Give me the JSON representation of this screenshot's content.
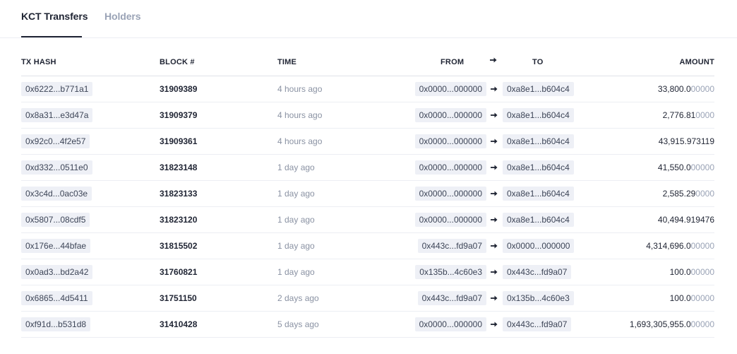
{
  "tabs": [
    {
      "label": "KCT Transfers"
    },
    {
      "label": "Holders"
    }
  ],
  "table": {
    "headers": {
      "tx_hash": "TX HASH",
      "block": "BLOCK #",
      "time": "TIME",
      "from": "FROM",
      "to": "TO",
      "amount": "AMOUNT"
    },
    "rows": [
      {
        "tx_hash": "0x6222...b771a1",
        "block": "31909389",
        "time": "4 hours ago",
        "from": "0x0000...000000",
        "to": "0xa8e1...b604c4",
        "amount_main": "33,800.0",
        "amount_dim": "00000"
      },
      {
        "tx_hash": "0x8a31...e3d47a",
        "block": "31909379",
        "time": "4 hours ago",
        "from": "0x0000...000000",
        "to": "0xa8e1...b604c4",
        "amount_main": "2,776.81",
        "amount_dim": "0000"
      },
      {
        "tx_hash": "0x92c0...4f2e57",
        "block": "31909361",
        "time": "4 hours ago",
        "from": "0x0000...000000",
        "to": "0xa8e1...b604c4",
        "amount_main": "43,915.973119",
        "amount_dim": ""
      },
      {
        "tx_hash": "0xd332...0511e0",
        "block": "31823148",
        "time": "1 day ago",
        "from": "0x0000...000000",
        "to": "0xa8e1...b604c4",
        "amount_main": "41,550.0",
        "amount_dim": "00000"
      },
      {
        "tx_hash": "0x3c4d...0ac03e",
        "block": "31823133",
        "time": "1 day ago",
        "from": "0x0000...000000",
        "to": "0xa8e1...b604c4",
        "amount_main": "2,585.29",
        "amount_dim": "0000"
      },
      {
        "tx_hash": "0x5807...08cdf5",
        "block": "31823120",
        "time": "1 day ago",
        "from": "0x0000...000000",
        "to": "0xa8e1...b604c4",
        "amount_main": "40,494.919476",
        "amount_dim": ""
      },
      {
        "tx_hash": "0x176e...44bfae",
        "block": "31815502",
        "time": "1 day ago",
        "from": "0x443c...fd9a07",
        "to": "0x0000...000000",
        "amount_main": "4,314,696.0",
        "amount_dim": "00000"
      },
      {
        "tx_hash": "0x0ad3...bd2a42",
        "block": "31760821",
        "time": "1 day ago",
        "from": "0x135b...4c60e3",
        "to": "0x443c...fd9a07",
        "amount_main": "100.0",
        "amount_dim": "00000"
      },
      {
        "tx_hash": "0x6865...4d5411",
        "block": "31751150",
        "time": "2 days ago",
        "from": "0x443c...fd9a07",
        "to": "0x135b...4c60e3",
        "amount_main": "100.0",
        "amount_dim": "00000"
      },
      {
        "tx_hash": "0xf91d...b531d8",
        "block": "31410428",
        "time": "5 days ago",
        "from": "0x0000...000000",
        "to": "0x443c...fd9a07",
        "amount_main": "1,693,305,955.0",
        "amount_dim": "00000"
      }
    ]
  },
  "icons": {
    "arrow": "arrow-right-icon"
  },
  "colors": {
    "text_primary": "#1f2433",
    "text_muted": "#8a92a3",
    "text_dim": "#9aa3b6",
    "pill_bg": "#eef0f6",
    "divider": "#eceef3"
  }
}
